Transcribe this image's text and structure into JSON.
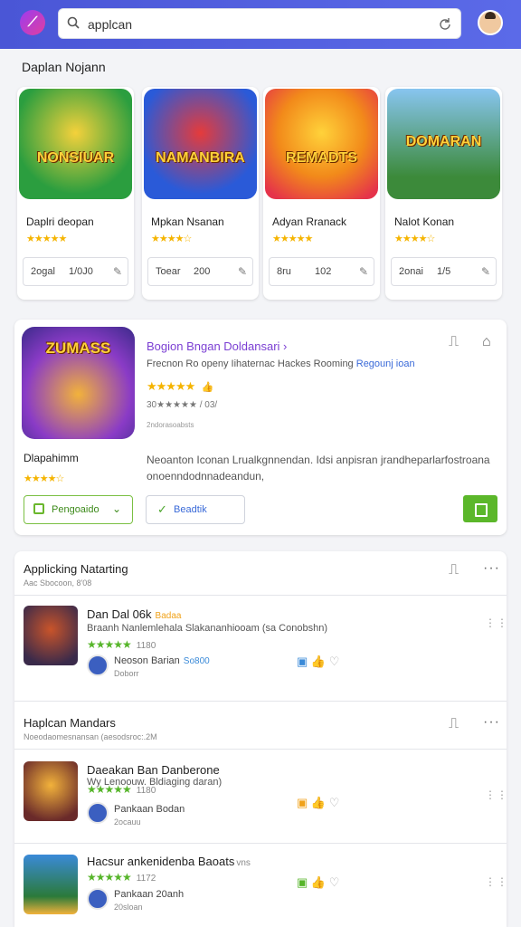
{
  "search": {
    "query": "applcan"
  },
  "section_title": "Daplan Nojann",
  "cards": [
    {
      "art_text": "NONSIUAR",
      "name": "Daplri deopan",
      "stars": "★★★★★",
      "meta1": "2ogal",
      "meta2": "1/0J0",
      "colors": [
        "#2b9e3f",
        "#f4d13b"
      ]
    },
    {
      "art_text": "NAMANBIRA",
      "name": "Mpkan Nsanan",
      "stars": "★★★★☆",
      "meta1": "Toear",
      "meta2": "200",
      "colors": [
        "#2a5ad8",
        "#e53b3b"
      ]
    },
    {
      "art_text": "REMADTS",
      "name": "Adyan Rranack",
      "stars": "★★★★★",
      "meta1": "8ru",
      "meta2": "102",
      "colors": [
        "#f28a1a",
        "#e5334a"
      ]
    },
    {
      "art_text": "DOMARAN",
      "name": "Nalot Konan",
      "stars": "★★★★☆",
      "meta1": "2onai",
      "meta2": "1/5",
      "colors": [
        "#3c8a3a",
        "#88c5f0"
      ]
    }
  ],
  "featured": {
    "art_text": "ZUMASS",
    "title": "Bogion Bngan Doldansari ›",
    "subtitle": "Frecnon Ro openy Iihaternac Hackes Rooming",
    "subtitle_link": "Regounj ioan",
    "stars": "★★★★★",
    "rating_text": "30★★★★★ / 03/",
    "small_text": "2ndorasoabsts",
    "name": "Dlapahimm",
    "stars2": "★★★★☆",
    "description": "Neoanton Iconan Lrualkgnnendan. Idsi anpisran jrandheparlarfostroana onoenndodnnadeandun,",
    "btn1_label": "Pengoaido",
    "btn2_label": "Beadtik"
  },
  "list1": {
    "heading": "Applicking Natarting",
    "sub": "Aac Sbocoon, 8'08",
    "row": {
      "title": "Dan Dal 06k",
      "tag": "Badaa",
      "sub": "Braanh Nanlemlehala Slakananhiooam (sa Conobshn)",
      "stars": "★★★★★",
      "num": "1180",
      "author": "Neoson Barian",
      "author_tag": "So800",
      "date": "Doborr"
    }
  },
  "list2": {
    "heading": "Haplcan Mandars",
    "sub": "Noeodaomesnansan (aesodsroc:.2M",
    "rows": [
      {
        "title": "Daeakan Ban Danberone",
        "gray": "•• ",
        "sub": "Wy Lenoouw. Bldiaging daran)",
        "stars": "★★★★★",
        "num": "1180",
        "author": "Pankaan Bodan",
        "author_tag": "",
        "date": "2ocauu"
      },
      {
        "title": "Hacsur ankenidenba Baoats",
        "gray": "vns",
        "sub": "",
        "stars": "★★★★★",
        "num": "1172",
        "author": "Pankaan 20anh",
        "author_tag": "",
        "date": "20sloan"
      }
    ]
  },
  "colors": {
    "topbar": "#4a56d6",
    "accent_green": "#5bb72a",
    "accent_purple": "#7b3fd3",
    "star_yellow": "#f5b400"
  }
}
